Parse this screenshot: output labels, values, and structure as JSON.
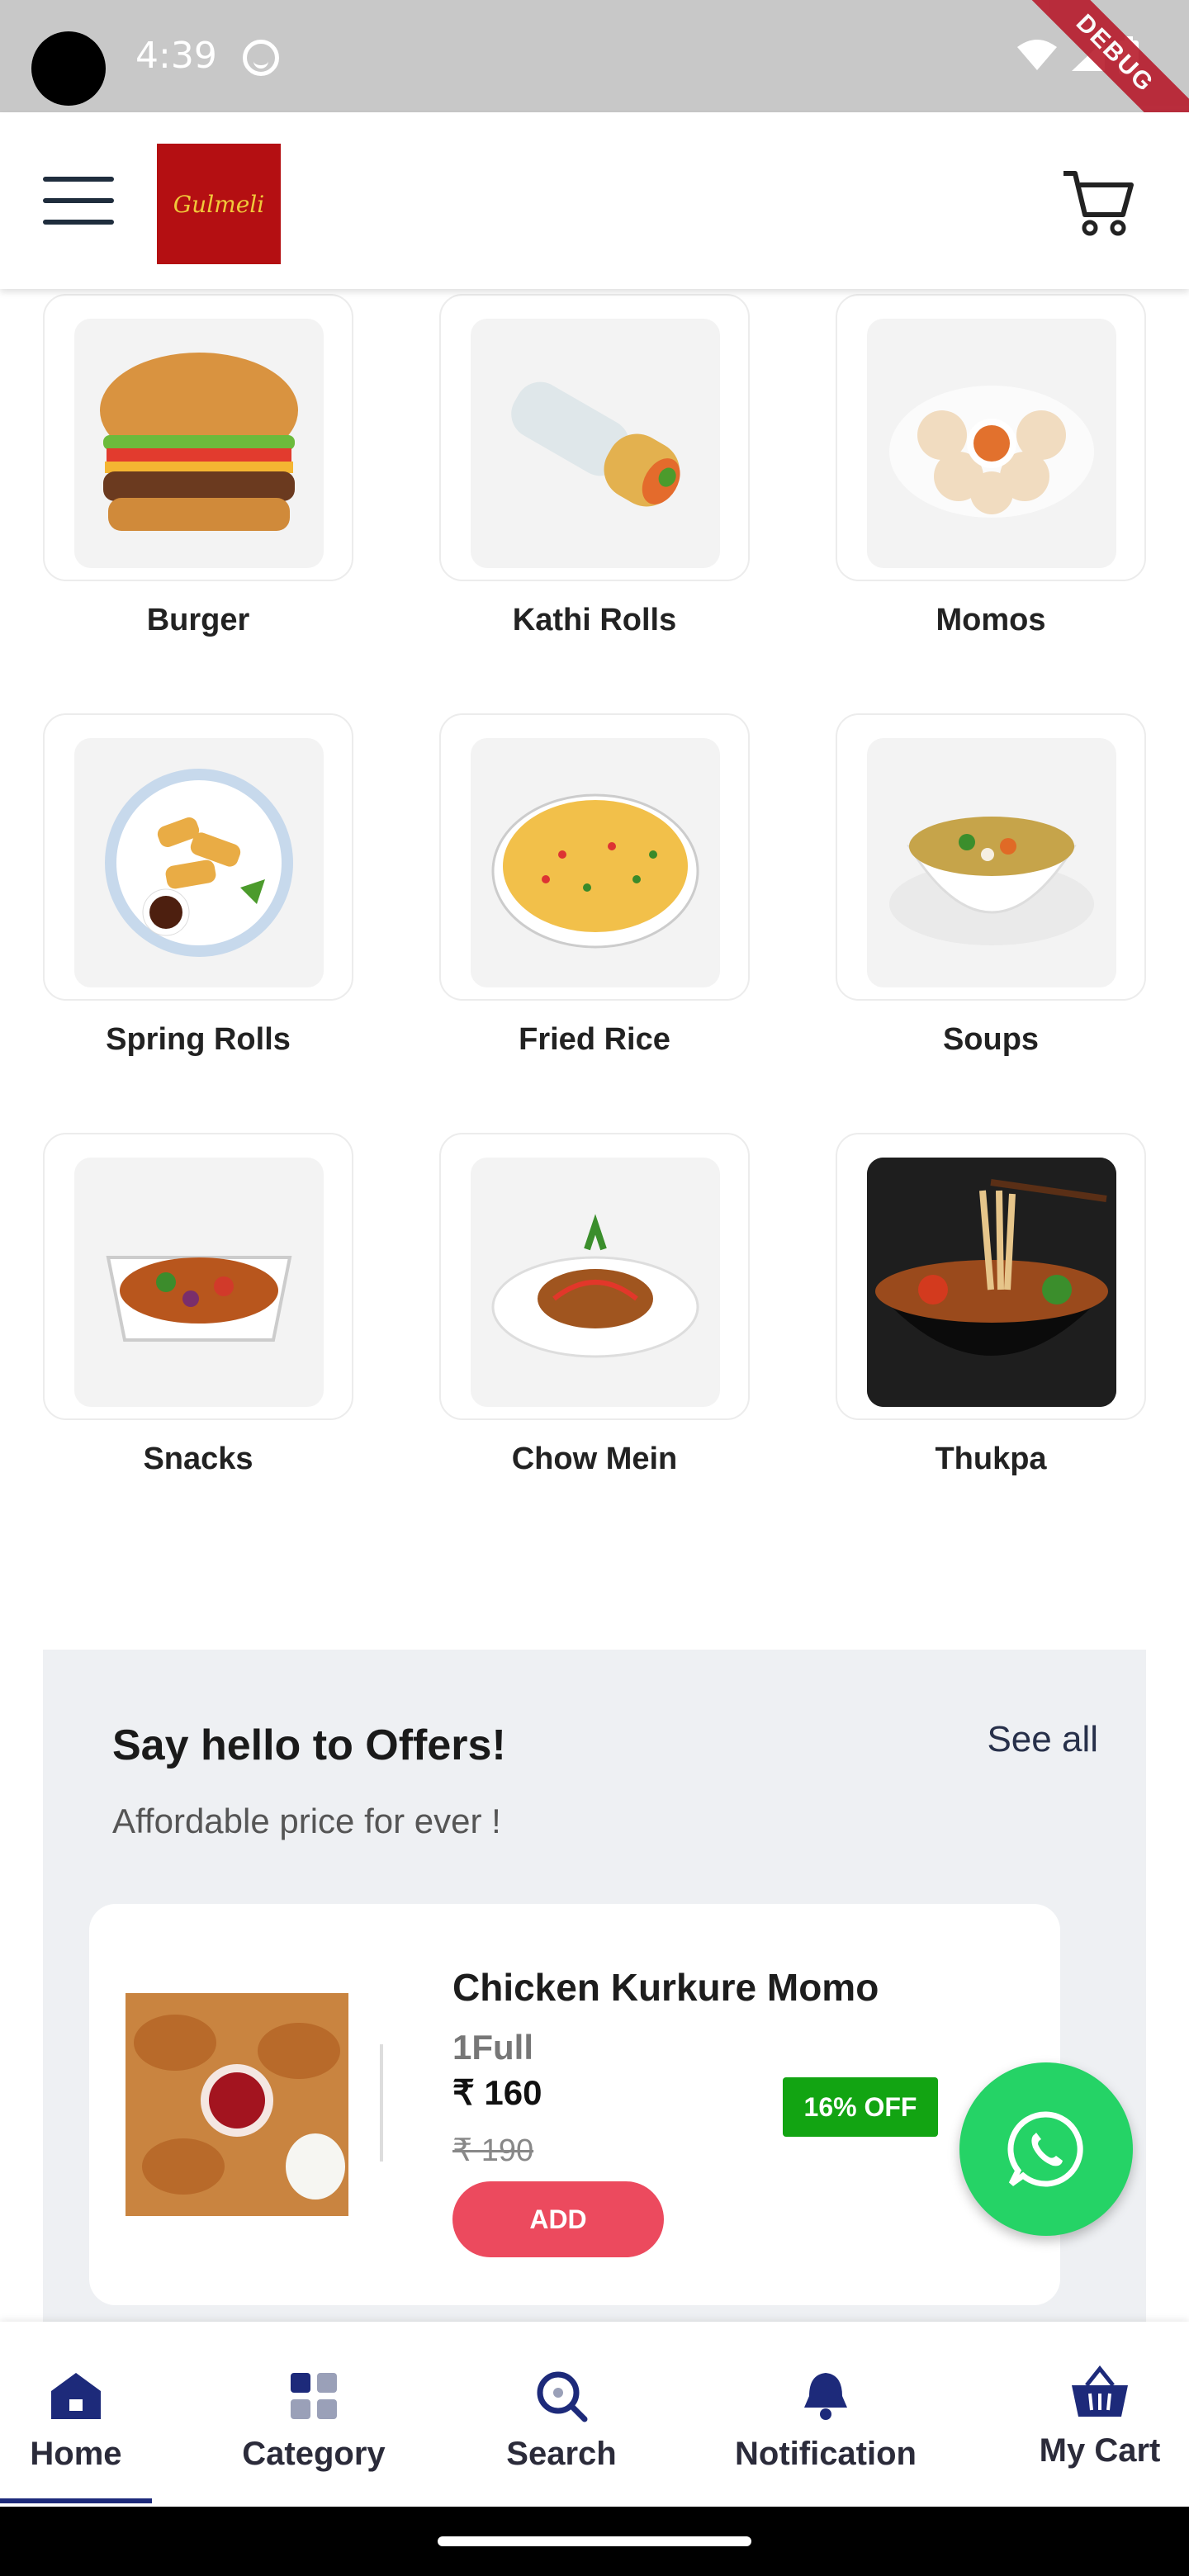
{
  "status_bar": {
    "time": "4:39",
    "debug_label": "DEBUG"
  },
  "app_bar": {
    "logo_text": "Gulmeli",
    "menu_icon": "hamburger-menu-icon",
    "cart_icon": "cart-icon"
  },
  "categories": [
    {
      "label": "Burger"
    },
    {
      "label": "Kathi Rolls"
    },
    {
      "label": "Momos"
    },
    {
      "label": "Spring Rolls"
    },
    {
      "label": "Fried Rice"
    },
    {
      "label": "Soups"
    },
    {
      "label": "Snacks"
    },
    {
      "label": "Chow Mein"
    },
    {
      "label": "Thukpa"
    }
  ],
  "offers": {
    "title": "Say hello to Offers!",
    "subtitle": "Affordable price for ever !",
    "see_all": "See all",
    "product": {
      "name": "Chicken Kurkure Momo",
      "variant": "1Full",
      "price": "₹ 160",
      "mrp": "₹ 190",
      "discount": "16% OFF",
      "add_label": "ADD"
    }
  },
  "bottom_nav": {
    "items": [
      {
        "label": "Home",
        "icon": "home-icon",
        "active": true
      },
      {
        "label": "Category",
        "icon": "category-icon"
      },
      {
        "label": "Search",
        "icon": "search-icon"
      },
      {
        "label": "Notification",
        "icon": "bell-icon"
      },
      {
        "label": "My Cart",
        "icon": "basket-icon"
      }
    ]
  },
  "colors": {
    "accent": "#1d2a7a",
    "add_button": "#ec4a5e",
    "discount_badge": "#12a412",
    "whatsapp": "#25d366",
    "logo_bg": "#b40f12"
  }
}
